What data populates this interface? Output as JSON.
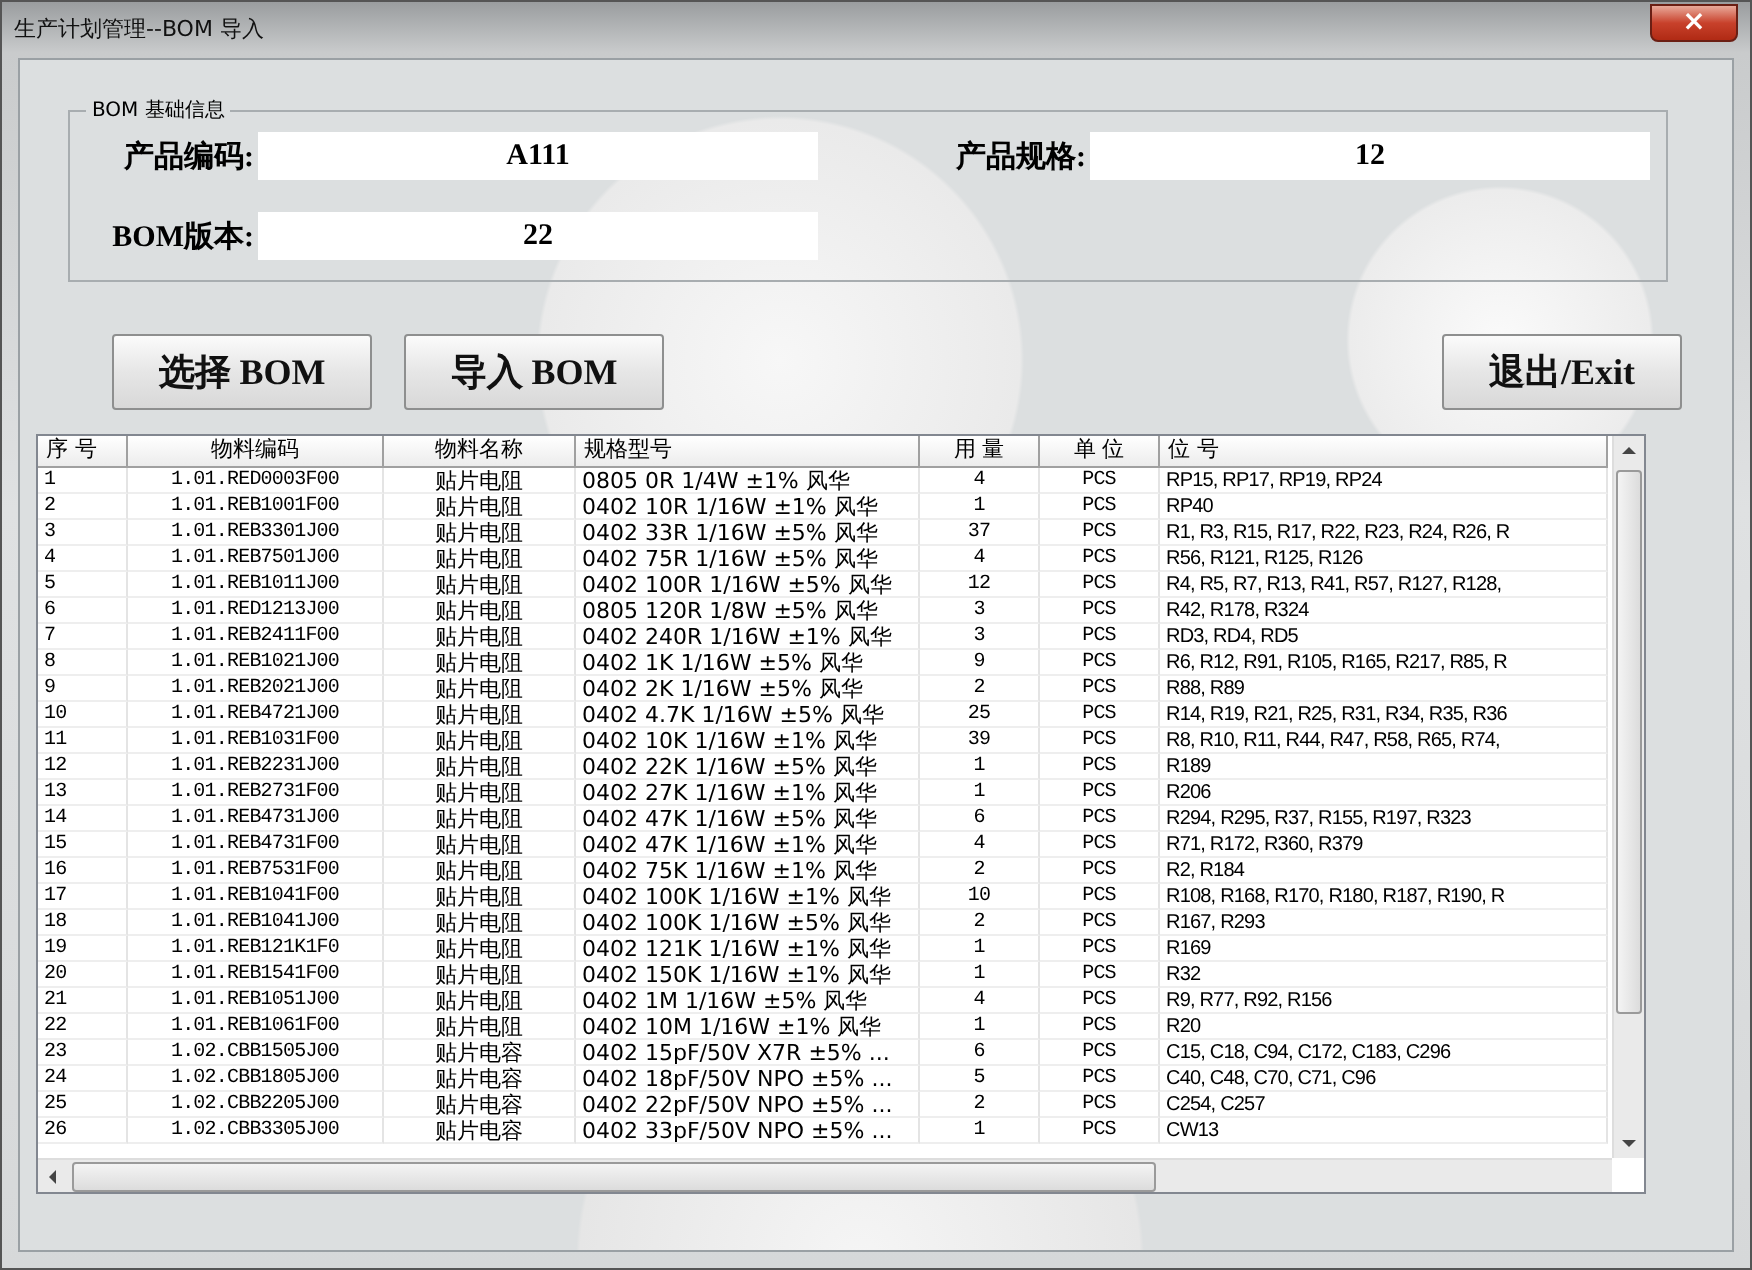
{
  "window": {
    "title": "生产计划管理--BOM 导入",
    "close": "×"
  },
  "bom_info": {
    "legend": "BOM 基础信息",
    "fields": [
      {
        "label": "产品编码:",
        "value": "A111"
      },
      {
        "label": "产品规格:",
        "value": "12"
      },
      {
        "label": "BOM版本:",
        "value": "22"
      }
    ]
  },
  "buttons": {
    "left": [
      "选择 BOM",
      "导入 BOM"
    ],
    "right": "退出/Exit"
  },
  "table": {
    "columns": [
      "序 号",
      "物料编码",
      "物料名称",
      "规格型号",
      "用 量",
      "单 位",
      "位 号"
    ],
    "rows": [
      [
        "1",
        "1.01.RED0003F00",
        "贴片电阻",
        "0805 0R 1/4W ±1% 风华",
        "4",
        "PCS",
        "RP15, RP17, RP19, RP24"
      ],
      [
        "2",
        "1.01.REB1001F00",
        "贴片电阻",
        "0402 10R 1/16W ±1%  风华",
        "1",
        "PCS",
        "RP40"
      ],
      [
        "3",
        "1.01.REB3301J00",
        "贴片电阻",
        "0402 33R  1/16W ±5% 风华",
        "37",
        "PCS",
        "R1, R3, R15, R17, R22, R23, R24, R26, R"
      ],
      [
        "4",
        "1.01.REB7501J00",
        "贴片电阻",
        "0402 75R 1/16W ±5% 风华",
        "4",
        "PCS",
        "R56, R121, R125, R126"
      ],
      [
        "5",
        "1.01.REB1011J00",
        "贴片电阻",
        "0402 100R 1/16W ±5% 风华",
        "12",
        "PCS",
        "R4, R5, R7, R13, R41, R57, R127, R128,"
      ],
      [
        "6",
        "1.01.RED1213J00",
        "贴片电阻",
        "0805 120R 1/8W ±5%  风华",
        "3",
        "PCS",
        "R42, R178, R324"
      ],
      [
        "7",
        "1.01.REB2411F00",
        "贴片电阻",
        "0402 240R 1/16W ±1% 风华",
        "3",
        "PCS",
        "RD3, RD4, RD5"
      ],
      [
        "8",
        "1.01.REB1021J00",
        "贴片电阻",
        "0402 1K 1/16W ±5% 风华",
        "9",
        "PCS",
        "R6, R12, R91, R105, R165, R217, R85, R"
      ],
      [
        "9",
        "1.01.REB2021J00",
        "贴片电阻",
        "0402 2K 1/16W ±5%  风华",
        "2",
        "PCS",
        "R88, R89"
      ],
      [
        "10",
        "1.01.REB4721J00",
        "贴片电阻",
        "0402 4.7K 1/16W ±5% 风华",
        "25",
        "PCS",
        "R14, R19, R21, R25, R31, R34, R35, R36"
      ],
      [
        "11",
        "1.01.REB1031F00",
        "贴片电阻",
        "0402 10K 1/16W ±1% 风华",
        "39",
        "PCS",
        "R8, R10, R11, R44, R47, R58, R65, R74,"
      ],
      [
        "12",
        "1.01.REB2231J00",
        "贴片电阻",
        "0402 22K 1/16W ±5%  风华",
        "1",
        "PCS",
        "R189"
      ],
      [
        "13",
        "1.01.REB2731F00",
        "贴片电阻",
        "0402 27K 1/16W ±1% 风华",
        "1",
        "PCS",
        "R206"
      ],
      [
        "14",
        "1.01.REB4731J00",
        "贴片电阻",
        "0402 47K  1/16W ±5% 风华",
        "6",
        "PCS",
        "R294, R295, R37, R155, R197, R323"
      ],
      [
        "15",
        "1.01.REB4731F00",
        "贴片电阻",
        "0402 47K  1/16W ±1% 风华",
        "4",
        "PCS",
        "R71, R172, R360, R379"
      ],
      [
        "16",
        "1.01.REB7531F00",
        "贴片电阻",
        "0402 75K  1/16W ±1%  风华",
        "2",
        "PCS",
        "R2, R184"
      ],
      [
        "17",
        "1.01.REB1041F00",
        "贴片电阻",
        "0402 100K 1/16W ±1% 风华",
        "10",
        "PCS",
        "R108, R168, R170, R180, R187, R190, R"
      ],
      [
        "18",
        "1.01.REB1041J00",
        "贴片电阻",
        "0402 100K 1/16W ±5% 风华",
        "2",
        "PCS",
        "R167, R293"
      ],
      [
        "19",
        "1.01.REB121K1F0",
        "贴片电阻",
        "0402 121K 1/16W ±1% 风华",
        "1",
        "PCS",
        "R169"
      ],
      [
        "20",
        "1.01.REB1541F00",
        "贴片电阻",
        "0402 150K  1/16W ±1% 风华",
        "1",
        "PCS",
        "R32"
      ],
      [
        "21",
        "1.01.REB1051J00",
        "贴片电阻",
        "0402 1M 1/16W ±5% 风华",
        "4",
        "PCS",
        "R9, R77, R92, R156"
      ],
      [
        "22",
        "1.01.REB1061F00",
        "贴片电阻",
        "0402 10M 1/16W ±1%  风华",
        "1",
        "PCS",
        "R20"
      ],
      [
        "23",
        "1.02.CBB1505J00",
        "贴片电容",
        "0402 15pF/50V X7R ±5% ...",
        "6",
        "PCS",
        "C15, C18, C94, C172, C183, C296"
      ],
      [
        "24",
        "1.02.CBB1805J00",
        "贴片电容",
        "0402 18pF/50V NPO ±5% ...",
        "5",
        "PCS",
        "C40, C48, C70, C71, C96"
      ],
      [
        "25",
        "1.02.CBB2205J00",
        "贴片电容",
        "0402 22pF/50V NPO ±5% ...",
        "2",
        "PCS",
        "C254, C257"
      ],
      [
        "26",
        "1.02.CBB3305J00",
        "贴片电容",
        "0402 33pF/50V NPO ±5% ...",
        "1",
        "PCS",
        "CW13"
      ]
    ]
  }
}
